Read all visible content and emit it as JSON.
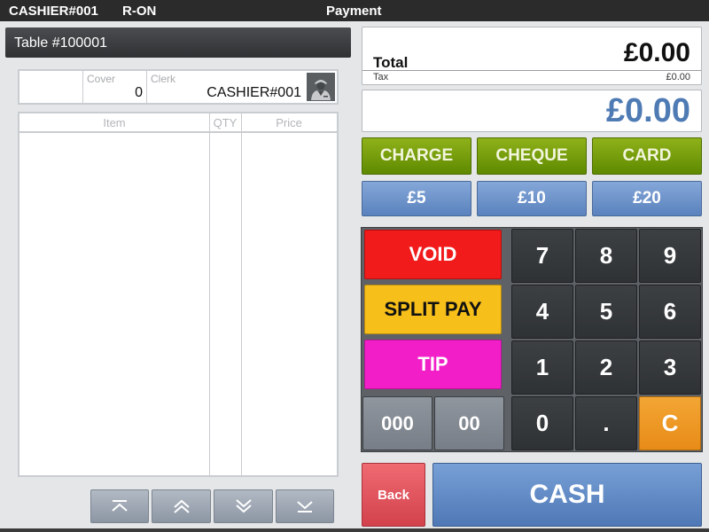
{
  "topbar": {
    "user": "CASHIER#001",
    "mode": "R-ON",
    "screen_title": "Payment"
  },
  "order": {
    "table_label": "Table  #100001",
    "cover_label": "Cover",
    "cover_value": "0",
    "clerk_label": "Clerk",
    "clerk_value": "CASHIER#001",
    "columns": {
      "item": "Item",
      "qty": "QTY",
      "price": "Price"
    },
    "items": []
  },
  "navigation": {
    "first": "scroll-to-top",
    "page_up": "page-up",
    "page_down": "page-down",
    "last": "scroll-to-bottom"
  },
  "totals": {
    "total_label": "Total",
    "total_value": "£0.00",
    "tax_label": "Tax",
    "tax_value": "£0.00",
    "tendered_value": "£0.00"
  },
  "payment_methods": [
    "CHARGE",
    "CHEQUE",
    "CARD"
  ],
  "quick_cash": [
    "£5",
    "£10",
    "£20"
  ],
  "actions": {
    "void": "VOID",
    "split_pay": "SPLIT PAY",
    "tip": "TIP",
    "triple_zero": "000",
    "double_zero": "00",
    "back": "Back",
    "cash": "CASH"
  },
  "keypad": [
    "7",
    "8",
    "9",
    "4",
    "5",
    "6",
    "1",
    "2",
    "3",
    "0",
    ".",
    "C"
  ],
  "colors": {
    "void": "#f11b1b",
    "split_pay": "#f6bf1a",
    "tip": "#f21fc9",
    "clear": "#f09a24",
    "tendered_text": "#4f7bb4",
    "green_button": "#76a00c",
    "blue_button": "#6f94cc"
  }
}
